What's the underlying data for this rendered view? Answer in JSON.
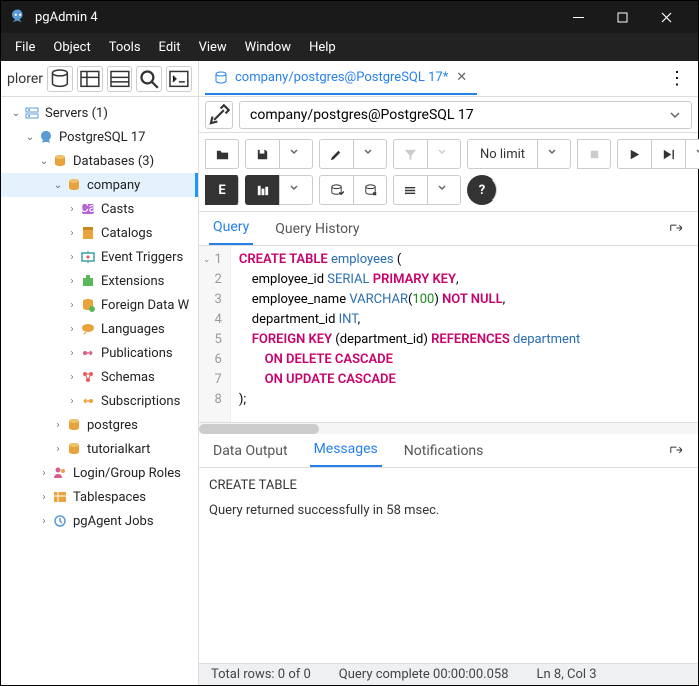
{
  "titlebar": {
    "title": "pgAdmin 4"
  },
  "menubar": [
    "File",
    "Object",
    "Tools",
    "Edit",
    "View",
    "Window",
    "Help"
  ],
  "sidebar": {
    "label": "plorer",
    "tree": [
      {
        "d": 0,
        "arrow": "v",
        "icon": "servers",
        "label": "Servers (1)"
      },
      {
        "d": 1,
        "arrow": "v",
        "icon": "elephant",
        "label": "PostgreSQL 17"
      },
      {
        "d": 2,
        "arrow": "v",
        "icon": "db",
        "label": "Databases (3)"
      },
      {
        "d": 3,
        "arrow": "v",
        "icon": "db1",
        "label": "company",
        "sel": true
      },
      {
        "d": 4,
        "arrow": ">",
        "icon": "cast",
        "label": "Casts"
      },
      {
        "d": 4,
        "arrow": ">",
        "icon": "catalog",
        "label": "Catalogs"
      },
      {
        "d": 4,
        "arrow": ">",
        "icon": "trigger",
        "label": "Event Triggers"
      },
      {
        "d": 4,
        "arrow": ">",
        "icon": "ext",
        "label": "Extensions"
      },
      {
        "d": 4,
        "arrow": ">",
        "icon": "fdw",
        "label": "Foreign Data W"
      },
      {
        "d": 4,
        "arrow": ">",
        "icon": "lang",
        "label": "Languages"
      },
      {
        "d": 4,
        "arrow": ">",
        "icon": "pub",
        "label": "Publications"
      },
      {
        "d": 4,
        "arrow": ">",
        "icon": "schema",
        "label": "Schemas"
      },
      {
        "d": 4,
        "arrow": ">",
        "icon": "sub",
        "label": "Subscriptions"
      },
      {
        "d": 3,
        "arrow": ">",
        "icon": "db1",
        "label": "postgres"
      },
      {
        "d": 3,
        "arrow": ">",
        "icon": "db1",
        "label": "tutorialkart"
      },
      {
        "d": 2,
        "arrow": ">",
        "icon": "roles",
        "label": "Login/Group Roles"
      },
      {
        "d": 2,
        "arrow": ">",
        "icon": "tblsp",
        "label": "Tablespaces"
      },
      {
        "d": 2,
        "arrow": ">",
        "icon": "agent",
        "label": "pgAgent Jobs"
      }
    ]
  },
  "tab": {
    "title": "company/postgres@PostgreSQL 17*"
  },
  "conn": {
    "text": "company/postgres@PostgreSQL 17"
  },
  "limit": "No limit",
  "editor_tabs": [
    "Query",
    "Query History"
  ],
  "lines": [
    "1",
    "2",
    "3",
    "4",
    "5",
    "6",
    "7",
    "8"
  ],
  "code_tokens": [
    [
      {
        "t": "CREATE TABLE",
        "c": "kw"
      },
      {
        "t": " "
      },
      {
        "t": "employees",
        "c": "fn"
      },
      {
        "t": " ("
      }
    ],
    [
      {
        "t": "    employee_id "
      },
      {
        "t": "SERIAL",
        "c": "fn"
      },
      {
        "t": " "
      },
      {
        "t": "PRIMARY KEY",
        "c": "kw"
      },
      {
        "t": ","
      }
    ],
    [
      {
        "t": "    employee_name "
      },
      {
        "t": "VARCHAR",
        "c": "fn"
      },
      {
        "t": "("
      },
      {
        "t": "100",
        "c": "num"
      },
      {
        "t": ") "
      },
      {
        "t": "NOT NULL",
        "c": "kw"
      },
      {
        "t": ","
      }
    ],
    [
      {
        "t": "    department_id "
      },
      {
        "t": "INT",
        "c": "fn"
      },
      {
        "t": ","
      }
    ],
    [
      {
        "t": "    "
      },
      {
        "t": "FOREIGN KEY",
        "c": "kw"
      },
      {
        "t": " (department_id) "
      },
      {
        "t": "REFERENCES",
        "c": "kw"
      },
      {
        "t": " "
      },
      {
        "t": "department",
        "c": "fn"
      }
    ],
    [
      {
        "t": "        "
      },
      {
        "t": "ON DELETE CASCADE",
        "c": "kw"
      }
    ],
    [
      {
        "t": "        "
      },
      {
        "t": "ON UPDATE CASCADE",
        "c": "kw"
      }
    ],
    [
      {
        "t": ");"
      }
    ]
  ],
  "output_tabs": [
    "Data Output",
    "Messages",
    "Notifications"
  ],
  "output": {
    "line1": "CREATE TABLE",
    "line2": "Query returned successfully in 58 msec."
  },
  "status": {
    "rows": "Total rows: 0 of 0",
    "time": "Query complete 00:00:00.058",
    "pos": "Ln 8, Col 3"
  }
}
